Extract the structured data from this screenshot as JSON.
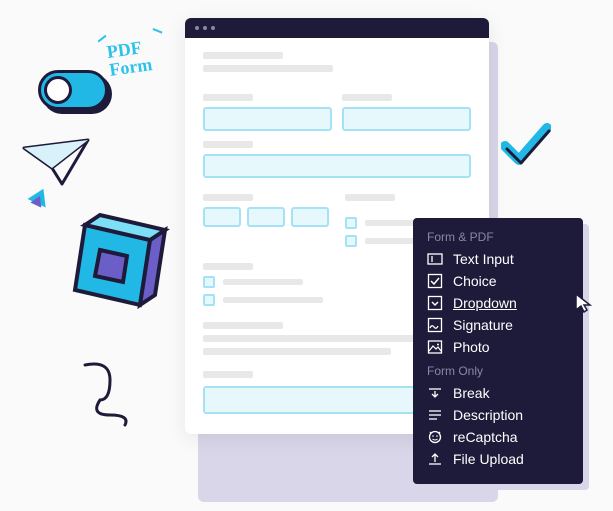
{
  "decor": {
    "badge_line1": "PDF",
    "badge_line2": "Form"
  },
  "menu": {
    "section1_heading": "Form & PDF",
    "section2_heading": "Form Only",
    "items_formpdf": [
      {
        "label": "Text Input",
        "icon": "text-input-icon"
      },
      {
        "label": "Choice",
        "icon": "choice-icon"
      },
      {
        "label": "Dropdown",
        "icon": "dropdown-icon"
      },
      {
        "label": "Signature",
        "icon": "signature-icon"
      },
      {
        "label": "Photo",
        "icon": "photo-icon"
      }
    ],
    "items_formonly": [
      {
        "label": "Break",
        "icon": "break-icon"
      },
      {
        "label": "Description",
        "icon": "description-icon"
      },
      {
        "label": "reCaptcha",
        "icon": "recaptcha-icon"
      },
      {
        "label": "File Upload",
        "icon": "file-upload-icon"
      }
    ],
    "hovered": "Dropdown"
  }
}
